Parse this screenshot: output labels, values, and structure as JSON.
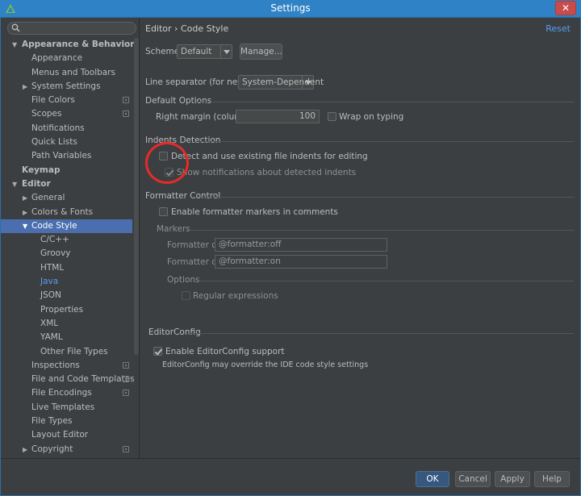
{
  "window": {
    "title": "Settings"
  },
  "search": {
    "placeholder": ""
  },
  "tree": [
    {
      "label": "Appearance & Behavior",
      "indent": 0,
      "arrow": "down",
      "bold": true
    },
    {
      "label": "Appearance",
      "indent": 1
    },
    {
      "label": "Menus and Toolbars",
      "indent": 1
    },
    {
      "label": "System Settings",
      "indent": 1,
      "arrow": "right"
    },
    {
      "label": "File Colors",
      "indent": 1,
      "project_icon": true
    },
    {
      "label": "Scopes",
      "indent": 1,
      "project_icon": true
    },
    {
      "label": "Notifications",
      "indent": 1
    },
    {
      "label": "Quick Lists",
      "indent": 1
    },
    {
      "label": "Path Variables",
      "indent": 1
    },
    {
      "label": "Keymap",
      "indent": 0,
      "bold": true
    },
    {
      "label": "Editor",
      "indent": 0,
      "arrow": "down",
      "bold": true
    },
    {
      "label": "General",
      "indent": 1,
      "arrow": "right"
    },
    {
      "label": "Colors & Fonts",
      "indent": 1,
      "arrow": "right"
    },
    {
      "label": "Code Style",
      "indent": 1,
      "arrow": "down",
      "selected": true
    },
    {
      "label": "C/C++",
      "indent": 2
    },
    {
      "label": "Groovy",
      "indent": 2
    },
    {
      "label": "HTML",
      "indent": 2
    },
    {
      "label": "Java",
      "indent": 2,
      "link": true
    },
    {
      "label": "JSON",
      "indent": 2
    },
    {
      "label": "Properties",
      "indent": 2
    },
    {
      "label": "XML",
      "indent": 2
    },
    {
      "label": "YAML",
      "indent": 2
    },
    {
      "label": "Other File Types",
      "indent": 2
    },
    {
      "label": "Inspections",
      "indent": 1,
      "project_icon": true
    },
    {
      "label": "File and Code Templates",
      "indent": 1,
      "project_icon": true
    },
    {
      "label": "File Encodings",
      "indent": 1,
      "project_icon": true
    },
    {
      "label": "Live Templates",
      "indent": 1
    },
    {
      "label": "File Types",
      "indent": 1
    },
    {
      "label": "Layout Editor",
      "indent": 1
    },
    {
      "label": "Copyright",
      "indent": 1,
      "arrow": "right",
      "project_icon": true
    }
  ],
  "header": {
    "breadcrumb": "Editor › Code Style",
    "reset": "Reset"
  },
  "scheme": {
    "label": "Scheme:",
    "value": "Default",
    "manage": "Manage..."
  },
  "line_separator": {
    "label": "Line separator (for new files):",
    "value": "System-Dependent"
  },
  "default_options": {
    "title": "Default Options",
    "right_margin_label": "Right margin (columns):",
    "right_margin_value": "100",
    "wrap_on_typing": "Wrap on typing",
    "wrap_checked": false
  },
  "indents_detection": {
    "title": "Indents Detection",
    "detect_label": "Detect and use existing file indents for editing",
    "detect_checked": false,
    "notify_label": "Show notifications about detected indents",
    "notify_checked": true
  },
  "formatter_control": {
    "title": "Formatter Control",
    "enable_label": "Enable formatter markers in comments",
    "enable_checked": false,
    "markers_title": "Markers",
    "off_label": "Formatter off:",
    "off_value": "@formatter:off",
    "on_label": "Formatter on:",
    "on_value": "@formatter:on",
    "options_title": "Options",
    "regex_label": "Regular expressions",
    "regex_checked": false
  },
  "editorconfig": {
    "title": "EditorConfig",
    "enable_label": "Enable EditorConfig support",
    "enable_checked": true,
    "note": "EditorConfig may override the IDE code style settings"
  },
  "footer": {
    "ok": "OK",
    "cancel": "Cancel",
    "apply": "Apply",
    "help": "Help"
  },
  "colors": {
    "titlebar": "#2f82c5",
    "selection": "#4b6eaf",
    "link": "#589df6",
    "annotation_circle": "#e82a2a"
  }
}
